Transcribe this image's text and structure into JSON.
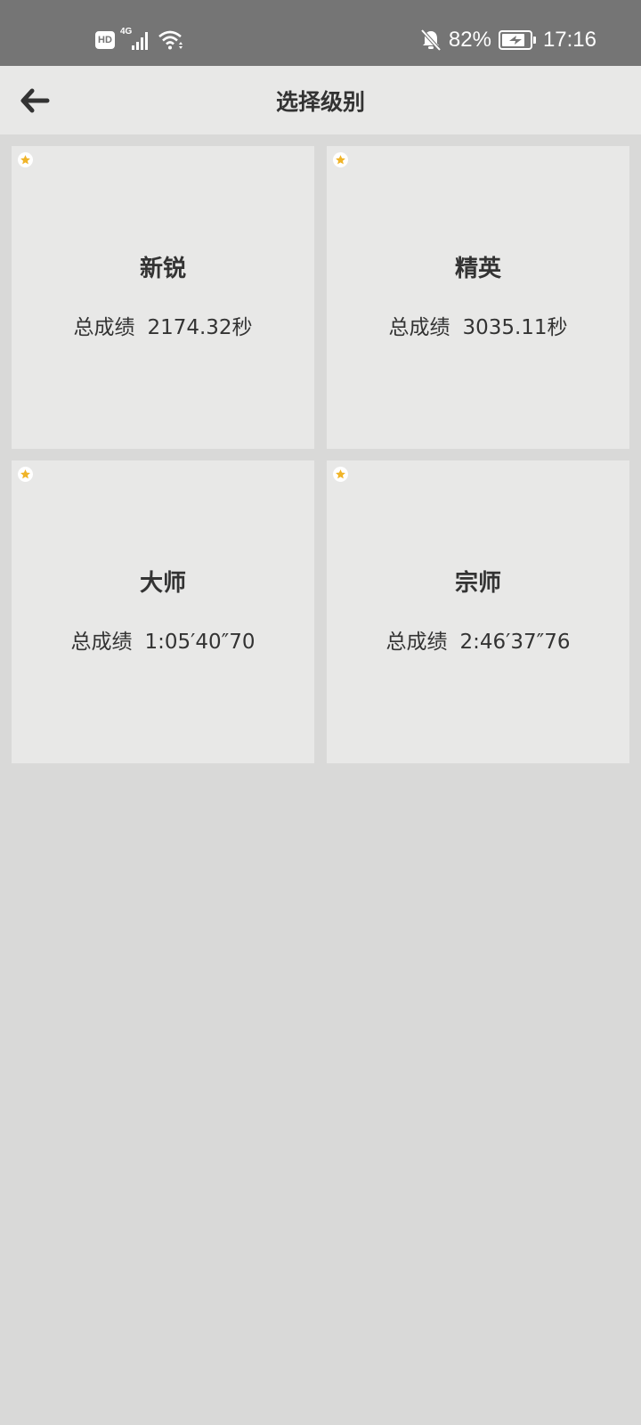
{
  "status_bar": {
    "hd_badge": "HD",
    "network": "4G",
    "battery_percent": "82%",
    "battery_level": 0.82,
    "time": "17:16",
    "icons": [
      "hd-icon",
      "cellular-signal-icon",
      "wifi-icon",
      "bell-off-icon",
      "battery-charging-icon"
    ]
  },
  "header": {
    "title": "选择级别",
    "back_icon": "arrow-left-icon"
  },
  "accent_color": "#f0b428",
  "levels": [
    {
      "name": "新锐",
      "score_label": "总成绩",
      "score_value": "2174.32秒"
    },
    {
      "name": "精英",
      "score_label": "总成绩",
      "score_value": "3035.11秒"
    },
    {
      "name": "大师",
      "score_label": "总成绩",
      "score_value": "1:05′40″70"
    },
    {
      "name": "宗师",
      "score_label": "总成绩",
      "score_value": "2:46′37″76"
    }
  ]
}
